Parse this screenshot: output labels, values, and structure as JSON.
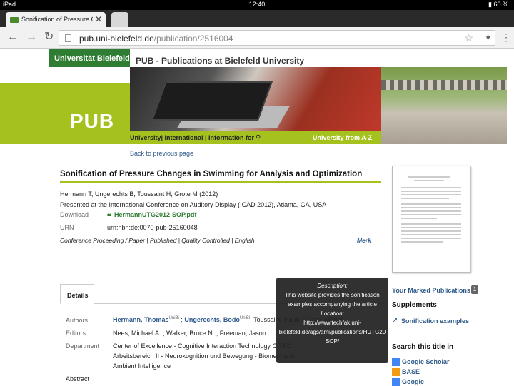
{
  "status": {
    "device": "iPad",
    "signal_icon": "wifi-icon",
    "time": "12:40",
    "battery": "60 %"
  },
  "tab": {
    "title": "Sonification of Pressure Ch",
    "close": "✕"
  },
  "toolbar": {
    "back": "←",
    "forward": "→",
    "reload": "↻",
    "url_host": "pub.uni-bielefeld.de",
    "url_path": "/publication/2516004",
    "star": "☆",
    "mic": "🎤",
    "menu": "⋮"
  },
  "header": {
    "university": "Universität Bielefeld",
    "site_title": "PUB - Publications at Bielefeld University",
    "pub_word": "PUB",
    "nav": "University| International | Information for",
    "atoz": "University from A-Z",
    "back_link": "Back to previous page"
  },
  "article": {
    "title": "Sonification of Pressure Changes in Swimming for Analysis and Optimization",
    "authors": "Hermann T, Ungerechts B, Toussaint H, Grote M (2012)",
    "presented": "Presented at the International Conference on Auditory Display (ICAD 2012), Atlanta, GA, USA",
    "download_label": "Download",
    "download_file": "HermannUTG2012-SOP.pdf",
    "urn_label": "URN",
    "urn": "urn:nbn:de:0070-pub-25160048",
    "kind": "Conference Proceeding / Paper | Published | Quality Controlled | English",
    "merk": "Merk"
  },
  "details": {
    "tab": "Details",
    "authors_label": "Authors",
    "author1": "Hermann, Thomas",
    "sup1": "UniBi",
    "author2": "Ungerechts, Bodo",
    "sup2": "UniBi",
    "authors_rest": "; Toussaint, Huub ; Grote, Marius",
    "sep": " ; ",
    "editors_label": "Editors",
    "editors": "Nees, Michael A. ; Walker, Bruce N. ; Freeman, Jason",
    "department_label": "Department",
    "dept1": "Center of Excellence - Cognitive Interaction Technology CITEC",
    "dept2": "Arbeitsbereich II - Neurokognition und Bewegung - Biomechanik",
    "dept3": "Ambient Intelligence",
    "abstract_label": "Abstract"
  },
  "tooltip": {
    "desc_label": "Description:",
    "desc1": "This website provides the sonification",
    "desc2": "examples accompanying the article",
    "loc_label": "Location:",
    "loc1": "http://www.techfak.uni-",
    "loc2": "bielefeld.de/ags/ami/publications/HUTG20",
    "loc3": "SOP/"
  },
  "sidebar": {
    "marked": "Your Marked Publications",
    "marked_count": "1",
    "supplements": "Supplements",
    "sonification": "Sonification examples",
    "search_title": "Search this title in",
    "search_items": [
      "Google Scholar",
      "BASE",
      "Google"
    ]
  },
  "colors": {
    "uni_green": "#2e7d32",
    "pub_lime": "#a4c11e",
    "link_blue": "#2e5a8a"
  }
}
